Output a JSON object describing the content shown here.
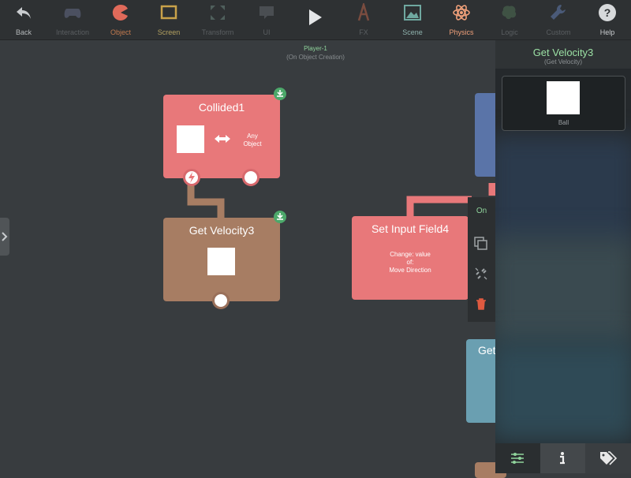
{
  "toolbar": {
    "items": [
      {
        "label": "Back",
        "icon": "back-arrow-icon"
      },
      {
        "label": "Interaction",
        "icon": "gamepad-icon"
      },
      {
        "label": "Object",
        "icon": "pacman-icon"
      },
      {
        "label": "Screen",
        "icon": "screen-icon"
      },
      {
        "label": "Transform",
        "icon": "transform-icon"
      },
      {
        "label": "UI",
        "icon": "speech-bubble-icon"
      },
      {
        "label": "",
        "icon": "play-icon"
      },
      {
        "label": "FX",
        "icon": "fx-icon"
      },
      {
        "label": "Scene",
        "icon": "scene-icon"
      },
      {
        "label": "Physics",
        "icon": "atom-icon"
      },
      {
        "label": "Logic",
        "icon": "brain-icon"
      },
      {
        "label": "Custom",
        "icon": "wrench-icon"
      },
      {
        "label": "Help",
        "icon": "help-icon"
      }
    ],
    "selected": "Physics",
    "colors": {
      "background": "#2e3133",
      "selected": "#f0a07a",
      "dim": "#5a5e61"
    }
  },
  "canvas": {
    "title": "Player-1",
    "subtitle": "(On Object Creation)",
    "nodes": {
      "collided": {
        "title": "Collided1",
        "target": "Any Object",
        "color": "#e8787a"
      },
      "get_velocity": {
        "title": "Get Velocity3",
        "color": "#a77d63"
      },
      "set_input": {
        "title": "Set Input Field4",
        "line1": "Change: value",
        "line2": "of:",
        "line3": "Move Direction",
        "color": "#e8787a"
      },
      "partial_blue": {
        "color": "#5a74a8"
      },
      "partial_teal": {
        "title": "Get",
        "color": "#6a9fb1"
      }
    }
  },
  "context_menu": {
    "on_label": "On",
    "items": [
      "copy-icon",
      "unlink-icon",
      "trash-icon"
    ]
  },
  "panel": {
    "title": "Get Velocity3",
    "subtitle": "(Get Velocity)",
    "asset_label": "Ball",
    "tabs": [
      "sliders-icon",
      "info-icon",
      "tags-icon"
    ],
    "active_tab": "sliders-icon"
  }
}
